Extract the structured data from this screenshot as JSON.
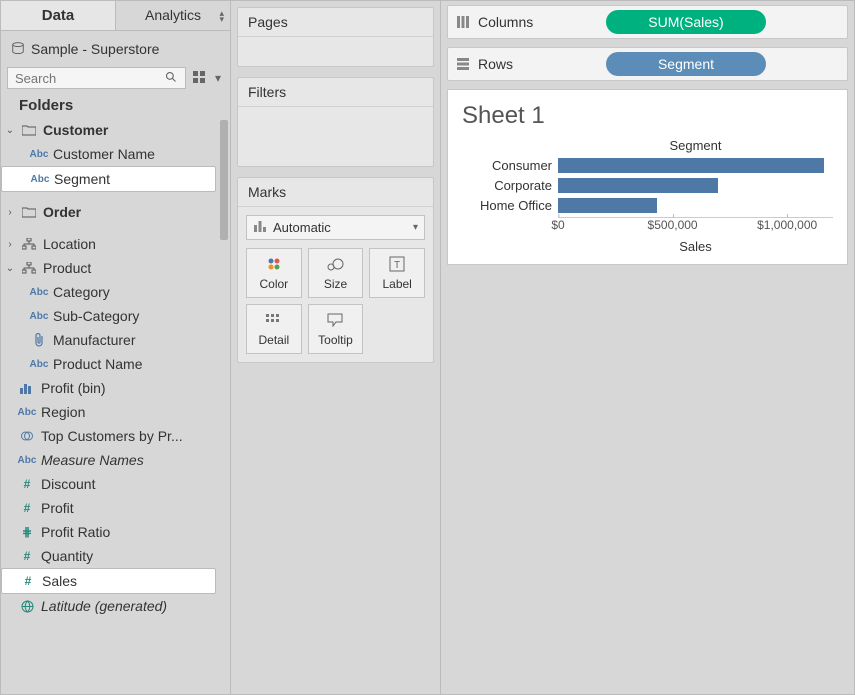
{
  "tabs": {
    "data": "Data",
    "analytics": "Analytics"
  },
  "datasource": {
    "name": "Sample - Superstore"
  },
  "search": {
    "placeholder": "Search"
  },
  "folders_header": "Folders",
  "tree": {
    "customer": {
      "label": "Customer",
      "customer_name": "Customer Name",
      "segment": "Segment"
    },
    "order": {
      "label": "Order"
    },
    "location": "Location",
    "product": {
      "label": "Product",
      "category": "Category",
      "sub_category": "Sub-Category",
      "manufacturer": "Manufacturer",
      "product_name": "Product Name"
    },
    "profit_bin": "Profit (bin)",
    "region": "Region",
    "top_customers": "Top Customers by Pr...",
    "measure_names": "Measure Names",
    "discount": "Discount",
    "profit": "Profit",
    "profit_ratio": "Profit Ratio",
    "quantity": "Quantity",
    "sales": "Sales",
    "latitude": "Latitude (generated)"
  },
  "cards": {
    "pages": "Pages",
    "filters": "Filters",
    "marks": "Marks",
    "mark_type": "Automatic",
    "color": "Color",
    "size": "Size",
    "label": "Label",
    "detail": "Detail",
    "tooltip": "Tooltip"
  },
  "shelves": {
    "columns": "Columns",
    "rows": "Rows",
    "columns_pill": "SUM(Sales)",
    "rows_pill": "Segment"
  },
  "sheet": {
    "title": "Sheet 1",
    "axis_title": "Sales",
    "dim_title": "Segment"
  },
  "chart_data": {
    "type": "bar",
    "orientation": "horizontal",
    "title": "Sheet 1",
    "ylabel": "Segment",
    "xlabel": "Sales",
    "categories": [
      "Consumer",
      "Corporate",
      "Home Office"
    ],
    "values": [
      1160000,
      700000,
      430000
    ],
    "xlim": [
      0,
      1200000
    ],
    "ticks": [
      0,
      500000,
      1000000
    ],
    "tick_labels": [
      "$0",
      "$500,000",
      "$1,000,000"
    ]
  }
}
